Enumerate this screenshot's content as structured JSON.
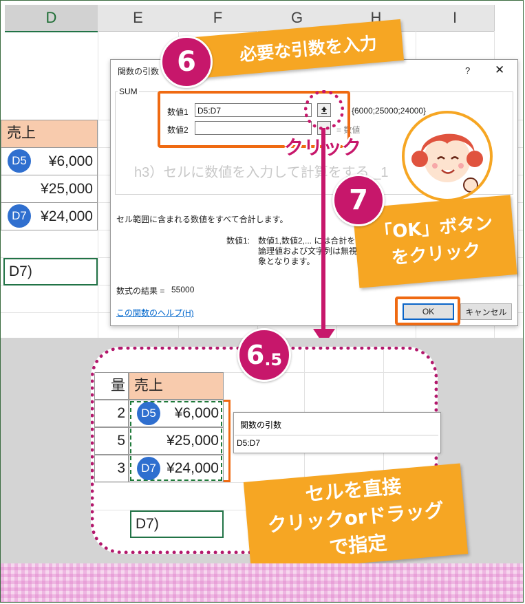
{
  "columns": [
    "D",
    "E",
    "F",
    "G",
    "H",
    "I"
  ],
  "sheet": {
    "header": "売上",
    "rows": [
      {
        "badge": "D5",
        "value": "¥6,000"
      },
      {
        "badge": "",
        "value": "¥25,000"
      },
      {
        "badge": "D7",
        "value": "¥24,000"
      }
    ],
    "formula_cell": "D7)"
  },
  "dialog": {
    "title": "関数の引数",
    "help": "?",
    "close": "✕",
    "function_name": "SUM",
    "arg1_label": "数値1",
    "arg1_value": "D5:D7",
    "arg1_result": "{6000;25000;24000}",
    "arg2_label": "数値2",
    "arg2_result": "= 数値",
    "ghost_text": "h3）セルに数値を入力して計算をする _1",
    "description": "セル範囲に含まれる数値をすべて合計します。",
    "arg_help_label": "数値1:",
    "arg_help_line1": "数値1,数値2,... には合計を求",
    "arg_help_line2": "論理値および文字列は無視さ",
    "arg_help_line3": "象となります。",
    "result_label": "数式の結果 =",
    "result_value": "55000",
    "help_link": "この関数のヘルプ(H)",
    "ok": "OK",
    "cancel": "キャンセル"
  },
  "callouts": {
    "step6_number": "6",
    "step6_text": "必要な引数を入力",
    "click_label": "クリック",
    "step7_number": "7",
    "step7_line1": "「OK」ボタン",
    "step7_line2": "をクリック",
    "step65_number": "6",
    "step65_sub": ".5",
    "bottom_line1": "セルを直接",
    "bottom_line2": "クリックorドラッグ",
    "bottom_line3": "で指定"
  },
  "zoom": {
    "left_header": "量",
    "header": "売上",
    "rows": [
      {
        "qty": "2",
        "badge": "D5",
        "value": "¥6,000"
      },
      {
        "qty": "5",
        "badge": "",
        "value": "¥25,000"
      },
      {
        "qty": "3",
        "badge": "D7",
        "value": "¥24,000"
      }
    ],
    "formula_cell": "D7)",
    "mini_dialog_title": "関数の引数",
    "mini_dialog_value": "D5:D7"
  },
  "colors": {
    "accent_pink": "#c7176b",
    "accent_orange": "#f6a623",
    "highlight_orange": "#ef6a12",
    "badge_blue": "#2f6fcf",
    "header_fill": "#f8cbad"
  }
}
